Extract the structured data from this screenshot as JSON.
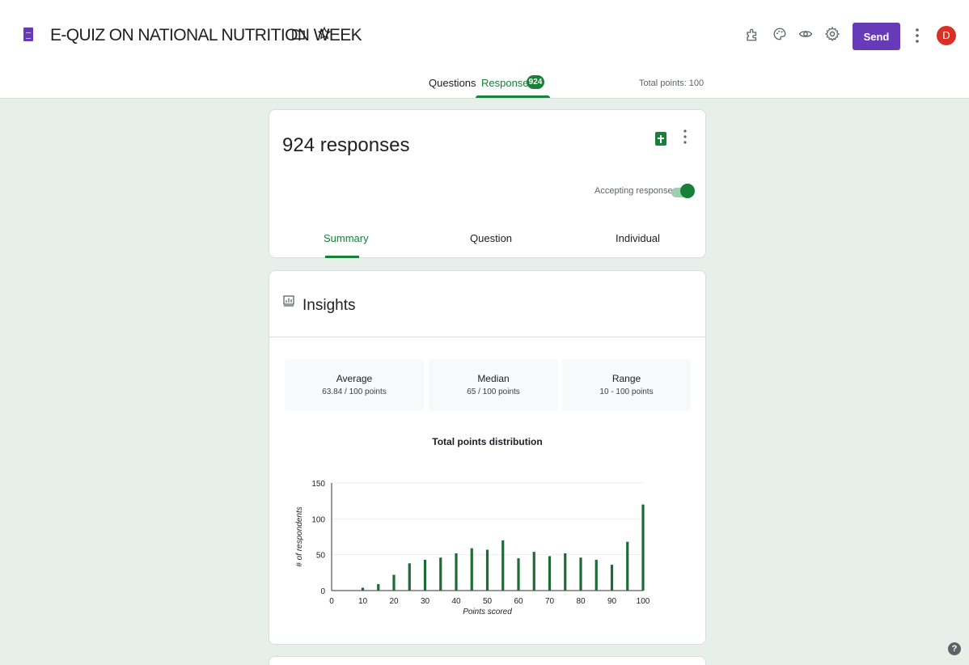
{
  "header": {
    "title": "E-QUIZ ON NATIONAL NUTRITION WEEK",
    "send_label": "Send",
    "avatar_initial": "D"
  },
  "tabs": {
    "questions": "Questions",
    "responses": "Responses",
    "responses_count": "924",
    "total_points": "Total points: 100"
  },
  "summary_card": {
    "count_text": "924 responses",
    "accepting_label": "Accepting responses",
    "accepting": true,
    "subtabs": [
      "Summary",
      "Question",
      "Individual"
    ]
  },
  "insights": {
    "title": "Insights",
    "stats": [
      {
        "label": "Average",
        "value": "63.84 / 100 points"
      },
      {
        "label": "Median",
        "value": "65 / 100 points"
      },
      {
        "label": "Range",
        "value": "10 - 100 points"
      }
    ]
  },
  "chart_data": {
    "type": "bar",
    "title": "Total points distribution",
    "xlabel": "Points scored",
    "ylabel": "# of respondents",
    "x": [
      10,
      15,
      20,
      25,
      30,
      35,
      40,
      45,
      50,
      55,
      60,
      65,
      70,
      75,
      80,
      85,
      90,
      95,
      100
    ],
    "values": [
      4,
      9,
      22,
      38,
      43,
      46,
      52,
      59,
      57,
      70,
      45,
      54,
      48,
      52,
      46,
      43,
      36,
      68,
      120
    ],
    "x_ticks": [
      0,
      10,
      20,
      30,
      40,
      50,
      60,
      70,
      80,
      90,
      100
    ],
    "y_ticks": [
      0,
      50,
      100,
      150
    ],
    "xlim": [
      0,
      100
    ],
    "ylim": [
      0,
      150
    ],
    "bar_color": "#1e6b37",
    "grid": true
  },
  "colors": {
    "accent": "#188038",
    "brand": "#673ab7",
    "background": "#e6efea"
  }
}
